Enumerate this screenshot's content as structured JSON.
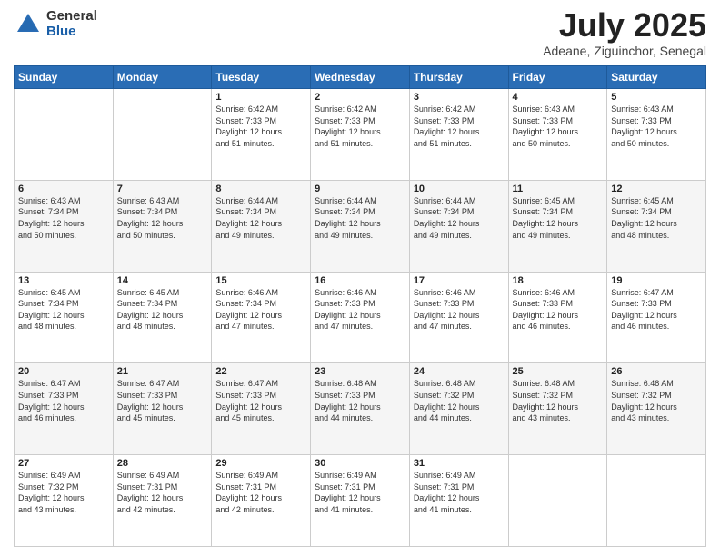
{
  "logo": {
    "general": "General",
    "blue": "Blue"
  },
  "header": {
    "month": "July 2025",
    "location": "Adeane, Ziguinchor, Senegal"
  },
  "days_of_week": [
    "Sunday",
    "Monday",
    "Tuesday",
    "Wednesday",
    "Thursday",
    "Friday",
    "Saturday"
  ],
  "weeks": [
    [
      {
        "day": "",
        "info": ""
      },
      {
        "day": "",
        "info": ""
      },
      {
        "day": "1",
        "info": "Sunrise: 6:42 AM\nSunset: 7:33 PM\nDaylight: 12 hours\nand 51 minutes."
      },
      {
        "day": "2",
        "info": "Sunrise: 6:42 AM\nSunset: 7:33 PM\nDaylight: 12 hours\nand 51 minutes."
      },
      {
        "day": "3",
        "info": "Sunrise: 6:42 AM\nSunset: 7:33 PM\nDaylight: 12 hours\nand 51 minutes."
      },
      {
        "day": "4",
        "info": "Sunrise: 6:43 AM\nSunset: 7:33 PM\nDaylight: 12 hours\nand 50 minutes."
      },
      {
        "day": "5",
        "info": "Sunrise: 6:43 AM\nSunset: 7:33 PM\nDaylight: 12 hours\nand 50 minutes."
      }
    ],
    [
      {
        "day": "6",
        "info": "Sunrise: 6:43 AM\nSunset: 7:34 PM\nDaylight: 12 hours\nand 50 minutes."
      },
      {
        "day": "7",
        "info": "Sunrise: 6:43 AM\nSunset: 7:34 PM\nDaylight: 12 hours\nand 50 minutes."
      },
      {
        "day": "8",
        "info": "Sunrise: 6:44 AM\nSunset: 7:34 PM\nDaylight: 12 hours\nand 49 minutes."
      },
      {
        "day": "9",
        "info": "Sunrise: 6:44 AM\nSunset: 7:34 PM\nDaylight: 12 hours\nand 49 minutes."
      },
      {
        "day": "10",
        "info": "Sunrise: 6:44 AM\nSunset: 7:34 PM\nDaylight: 12 hours\nand 49 minutes."
      },
      {
        "day": "11",
        "info": "Sunrise: 6:45 AM\nSunset: 7:34 PM\nDaylight: 12 hours\nand 49 minutes."
      },
      {
        "day": "12",
        "info": "Sunrise: 6:45 AM\nSunset: 7:34 PM\nDaylight: 12 hours\nand 48 minutes."
      }
    ],
    [
      {
        "day": "13",
        "info": "Sunrise: 6:45 AM\nSunset: 7:34 PM\nDaylight: 12 hours\nand 48 minutes."
      },
      {
        "day": "14",
        "info": "Sunrise: 6:45 AM\nSunset: 7:34 PM\nDaylight: 12 hours\nand 48 minutes."
      },
      {
        "day": "15",
        "info": "Sunrise: 6:46 AM\nSunset: 7:34 PM\nDaylight: 12 hours\nand 47 minutes."
      },
      {
        "day": "16",
        "info": "Sunrise: 6:46 AM\nSunset: 7:33 PM\nDaylight: 12 hours\nand 47 minutes."
      },
      {
        "day": "17",
        "info": "Sunrise: 6:46 AM\nSunset: 7:33 PM\nDaylight: 12 hours\nand 47 minutes."
      },
      {
        "day": "18",
        "info": "Sunrise: 6:46 AM\nSunset: 7:33 PM\nDaylight: 12 hours\nand 46 minutes."
      },
      {
        "day": "19",
        "info": "Sunrise: 6:47 AM\nSunset: 7:33 PM\nDaylight: 12 hours\nand 46 minutes."
      }
    ],
    [
      {
        "day": "20",
        "info": "Sunrise: 6:47 AM\nSunset: 7:33 PM\nDaylight: 12 hours\nand 46 minutes."
      },
      {
        "day": "21",
        "info": "Sunrise: 6:47 AM\nSunset: 7:33 PM\nDaylight: 12 hours\nand 45 minutes."
      },
      {
        "day": "22",
        "info": "Sunrise: 6:47 AM\nSunset: 7:33 PM\nDaylight: 12 hours\nand 45 minutes."
      },
      {
        "day": "23",
        "info": "Sunrise: 6:48 AM\nSunset: 7:33 PM\nDaylight: 12 hours\nand 44 minutes."
      },
      {
        "day": "24",
        "info": "Sunrise: 6:48 AM\nSunset: 7:32 PM\nDaylight: 12 hours\nand 44 minutes."
      },
      {
        "day": "25",
        "info": "Sunrise: 6:48 AM\nSunset: 7:32 PM\nDaylight: 12 hours\nand 43 minutes."
      },
      {
        "day": "26",
        "info": "Sunrise: 6:48 AM\nSunset: 7:32 PM\nDaylight: 12 hours\nand 43 minutes."
      }
    ],
    [
      {
        "day": "27",
        "info": "Sunrise: 6:49 AM\nSunset: 7:32 PM\nDaylight: 12 hours\nand 43 minutes."
      },
      {
        "day": "28",
        "info": "Sunrise: 6:49 AM\nSunset: 7:31 PM\nDaylight: 12 hours\nand 42 minutes."
      },
      {
        "day": "29",
        "info": "Sunrise: 6:49 AM\nSunset: 7:31 PM\nDaylight: 12 hours\nand 42 minutes."
      },
      {
        "day": "30",
        "info": "Sunrise: 6:49 AM\nSunset: 7:31 PM\nDaylight: 12 hours\nand 41 minutes."
      },
      {
        "day": "31",
        "info": "Sunrise: 6:49 AM\nSunset: 7:31 PM\nDaylight: 12 hours\nand 41 minutes."
      },
      {
        "day": "",
        "info": ""
      },
      {
        "day": "",
        "info": ""
      }
    ]
  ]
}
